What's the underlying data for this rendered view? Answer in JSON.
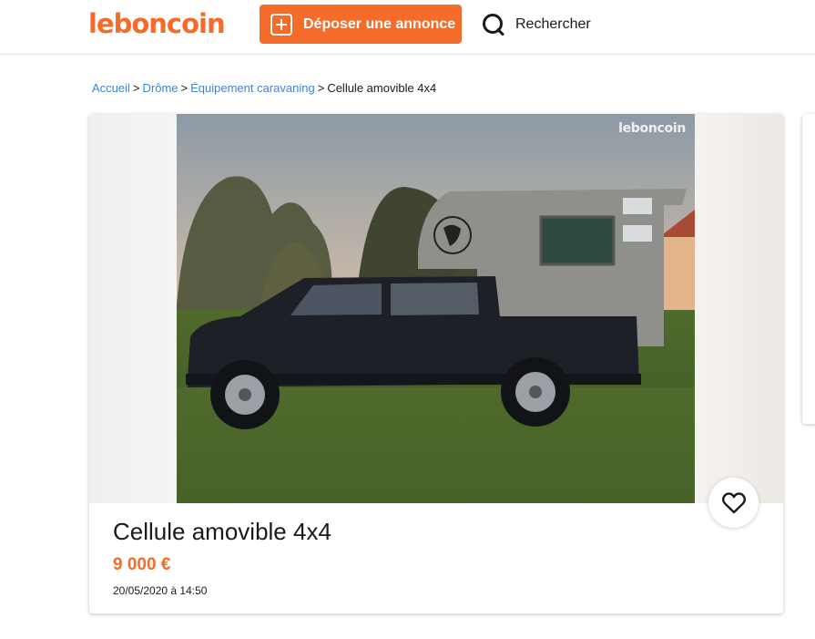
{
  "header": {
    "logo_text": "leboncoin",
    "deposit_label": "Déposer une annonce",
    "deposit_icon": "plus-square-icon",
    "search_label": "Rechercher",
    "search_icon": "magnifier-icon",
    "brand_color": "#f56b2a"
  },
  "breadcrumb": {
    "items": [
      "Accueil",
      "Drôme",
      "Équipement caravaning"
    ],
    "current": "Cellule amovible 4x4",
    "separator": ">"
  },
  "listing": {
    "title": "Cellule amovible 4x4",
    "price": "9 000 €",
    "date": "20/05/2020 à 14:50",
    "watermark": "leboncoin",
    "favorite_icon": "heart-icon",
    "price_color": "#f56b2a"
  }
}
